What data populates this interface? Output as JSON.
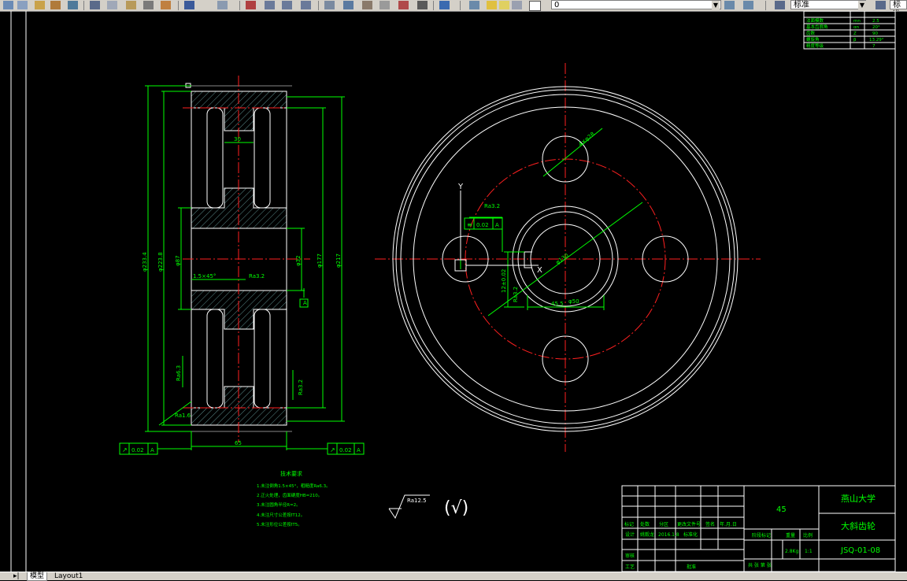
{
  "toolbar": {
    "layer_value": "0",
    "style_value": "标准",
    "style_value_2": "标准"
  },
  "layout_tabs": [
    "模型",
    "Layout1"
  ],
  "tech_requirements": {
    "title": "技术要求",
    "lines": [
      "1.未注倒角1.5×45°，粗糙度Ra6.3。",
      "2.正火处理，齿面硬度HB=210。",
      "3.未注圆角半径R=2。",
      "4.未注尺寸公差按IT12。",
      "5.未注形位公差按IT5。"
    ]
  },
  "roughness": {
    "general": "Ra12.5",
    "other": "(√)"
  },
  "dims_side": {
    "d_tip": "φ233.4",
    "d_root": "φ223.8",
    "d_hub": "φ87",
    "d_bore": "φ32",
    "d_web1": "φ177",
    "d_web2": "φ217",
    "chamfer": "1.5×45°",
    "web_thk": "30",
    "width": "65",
    "ra_left": "Ra1.6",
    "ra_bore": "Ra3.2",
    "ra_face1": "Ra6.3",
    "ra_face2": "Ra3.2",
    "datum": "A",
    "runout1_tol": "0.02",
    "runout1_ref": "A",
    "runout2_tol": "0.02",
    "runout2_ref": "A"
  },
  "dims_front": {
    "hole_dia": "4×φ28",
    "pitch_circle": "φ130",
    "bore": "φ50",
    "keyway_w": "12±0.02",
    "keyway_h": "45.5",
    "ra_key": "Ra3.2",
    "ra_key2": "Ra3.2",
    "sym_tol": "0.02",
    "sym_ref": "A",
    "axis_y": "Y",
    "axis_x": "X"
  },
  "param_table": [
    [
      "法面模数",
      "mn",
      "2.5"
    ],
    [
      "基本齿廓角",
      "αn",
      "20°"
    ],
    [
      "齿数",
      "Z",
      "90"
    ],
    [
      "螺旋角",
      "β",
      "13.29°"
    ],
    [
      "精度等级",
      "",
      "7"
    ]
  ],
  "title_block": {
    "material": "45",
    "school": "燕山大学",
    "part_name": "大斜齿轮",
    "drawing_no": "JSQ-01-08",
    "weight": "2.8Kg",
    "scale": "1:1",
    "designer_role": "设计",
    "designer": "姚毅龙",
    "date": "2016.1.8",
    "std": "标准化",
    "header_cells": [
      "标记",
      "处数",
      "分区",
      "更改文件号",
      "签名",
      "年.月.日"
    ],
    "stage_label": "阶段标记",
    "weight_label": "重量",
    "scale_label": "比例",
    "review": "审核",
    "process": "工艺",
    "approve": "批准",
    "sheet": "共  张   第  张"
  },
  "colors": {
    "background": "#000000",
    "outline": "#ffffff",
    "dims": "#00ff00",
    "center": "#ff0000",
    "hatch": "#00ffff"
  }
}
